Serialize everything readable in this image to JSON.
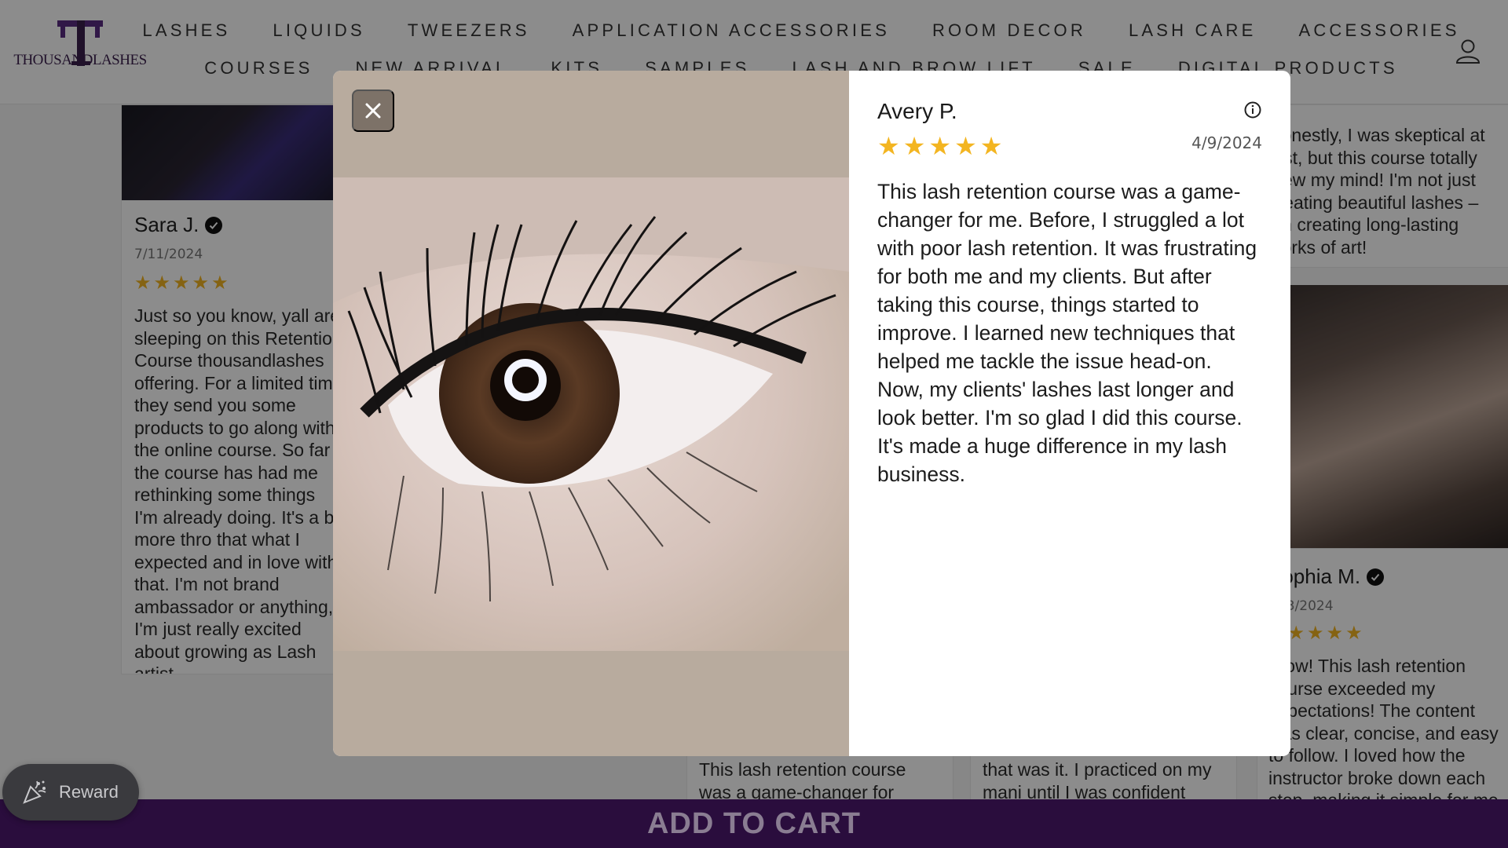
{
  "brand": {
    "name": "THOUSANDLASHES",
    "accent": "#3b1f4e"
  },
  "nav": {
    "row1": [
      "LASHES",
      "LIQUIDS",
      "TWEEZERS",
      "APPLICATION ACCESSORIES",
      "ROOM DECOR",
      "LASH CARE",
      "ACCESSORIES"
    ],
    "row2": [
      "COURSES",
      "NEW ARRIVAL",
      "KITS",
      "SAMPLES",
      "LASH AND BROW LIFT",
      "SALE",
      "DIGITAL PRODUCTS"
    ],
    "account_icon": "user-icon"
  },
  "background_reviews": {
    "left": {
      "name": "Sara J.",
      "date": "7/11/2024",
      "rating": 5,
      "body": "Just so you know, yall are sleeping on this Retention Course thousandlashes offering. For a limited time they send you some products to go along with the online course. So far the course has had me rethinking some things I'm already doing. It's a bit more thro that what I expected and in love with that. I'm not brand ambassador or anything, I'm just really excited about growing as Lash artist."
    },
    "right_top": {
      "body": "Honestly, I was skeptical at first, but this course totally blew my mind! I'm not just creating beautiful lashes – I'm creating long-lasting works of art!"
    },
    "right_bottom": {
      "name": "Sophia M.",
      "date": "…/3/2024",
      "rating": 5,
      "body": "Wow! This lash retention course exceeded my expectations! The content was clear, concise, and easy to follow. I loved how the instructor broke down each step, making it simple for me"
    },
    "mid1": {
      "body": "This lash retention course was a game-changer for"
    },
    "mid2": {
      "body": "that was it. I practiced on my mani until I was confident"
    }
  },
  "modal": {
    "close_icon": "close-icon",
    "info_icon": "info-icon",
    "reviewer": "Avery P.",
    "date": "4/9/2024",
    "rating": 5,
    "body": "This lash retention course was a game-changer for me. Before, I struggled a lot with poor lash retention. It was frustrating for both me and my clients. But after taking this course, things started to improve. I learned new techniques that helped me tackle the issue head-on. Now, my clients' lashes last longer and look better. I'm so glad I did this course. It's made a huge difference in my lash business."
  },
  "reward": {
    "label": "Reward",
    "icon": "party-popper-icon"
  },
  "cart": {
    "label": "ADD TO CART"
  },
  "colors": {
    "star": "#f3b521",
    "cart_bar": "#2a0d3d",
    "modal_media_bg": "#b8ab9e"
  }
}
